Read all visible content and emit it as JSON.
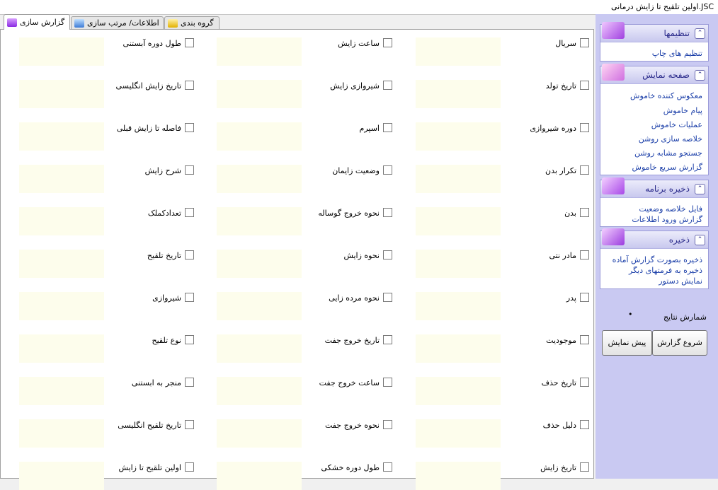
{
  "window": {
    "title": "اولین تلقیح تا زایش درمانی.JSC"
  },
  "tabs": [
    {
      "label": "گزارش سازی",
      "active": true
    },
    {
      "label": "اطلاعات/ مرتب سازی",
      "active": false
    },
    {
      "label": "گروه بندی",
      "active": false
    }
  ],
  "fields": {
    "col1": [
      "سریال",
      "تاریخ تولد",
      "دوره شیروازی",
      "تکرار بدن",
      "بدن",
      "مادر نتی",
      "پدر",
      "موجودیت",
      "تاریخ حذف",
      "دلیل حذف",
      "تاریخ زایش"
    ],
    "col2": [
      "ساعت زایش",
      "شیروازی زایش",
      "اسپرم",
      "وضعیت زایمان",
      "نحوه خروج گوساله",
      "نحوه زایش",
      "نحوه مرده زایی",
      "تاریخ خروج جفت",
      "ساعت خروج جفت",
      "نحوه خروج جفت",
      "طول دوره خشکی"
    ],
    "col3": [
      "طول دوره آبستنی",
      "تاریخ زایش انگلیسی",
      "فاصله تا زایش قبلی",
      "شرح زایش",
      "تعدادکملک",
      "تاریخ تلقیح",
      "شیروازی",
      "نوع تلقیح",
      "منجر به ابستنی",
      "تاریخ تلقیح انگلیسی",
      "اولین تلقیح تا زایش"
    ]
  },
  "sidebar": {
    "settings": {
      "title": "تنظیمها",
      "links": [
        "تنظیم های چاپ"
      ]
    },
    "display": {
      "title": "صفحه نمایش",
      "links": [
        "معکوس کننده خاموش",
        "پیام خاموش",
        "عملیات خاموش",
        "خلاصه سازی روشن",
        "جستجو مشابه روشن",
        "گزارش سریع خاموش"
      ]
    },
    "save_program": {
      "title": "ذخیره برنامه",
      "links": [
        "فایل خلاصه وضعیت",
        "گزارش ورود اطلاعات"
      ]
    },
    "save": {
      "title": "ذخیره",
      "links": [
        "ذخیره بصورت گزارش آماده",
        "ذخیره به فرمتهای دیگر",
        "نمایش دستور"
      ]
    },
    "result_count_label": "شمارش نتایج",
    "result_count_value": "•",
    "start_button": "شروع گزارش",
    "preview_button": "پیش نمایش"
  },
  "colors": {
    "sidebar_bg": "#c9c9f2",
    "field_box": "#fdfdec",
    "link": "#1a3ea8"
  }
}
